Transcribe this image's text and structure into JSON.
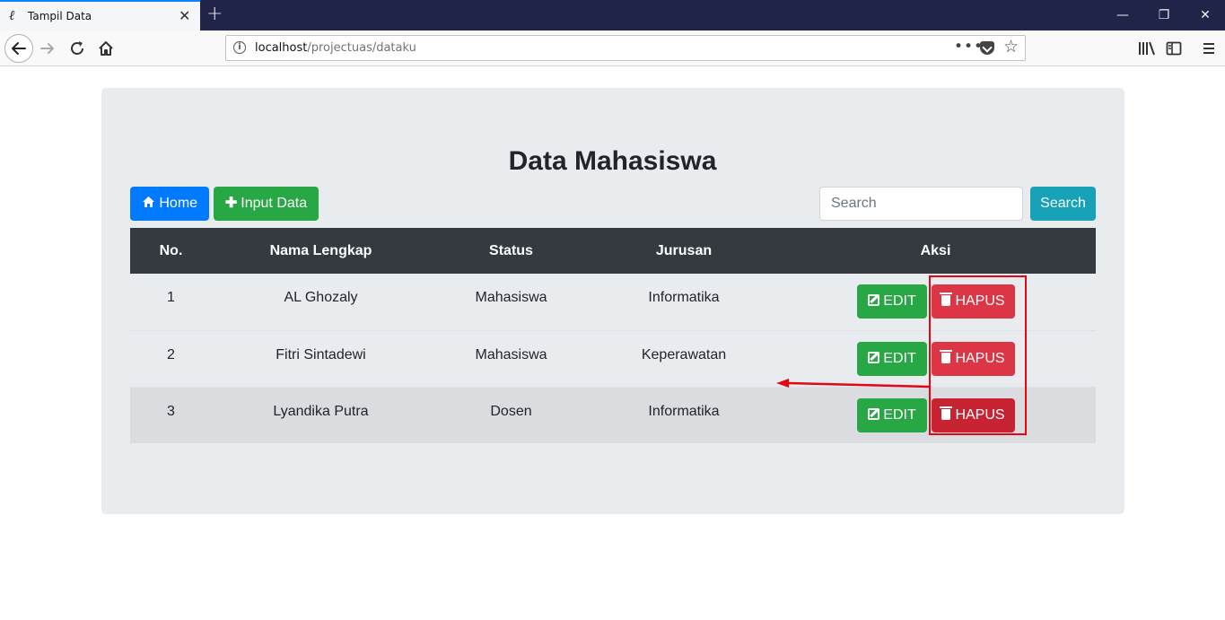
{
  "browser": {
    "tab_title": "Tampil Data",
    "tab_favicon": "ℓ",
    "tab_close": "✕",
    "new_tab": "+",
    "url_host": "localhost",
    "url_path": "/projectuas/dataku",
    "url_more": "•••",
    "window_minimize": "—",
    "window_restore": "❐",
    "window_close": "✕"
  },
  "page": {
    "title": "Data Mahasiswa",
    "home_button": "Home",
    "input_button": "Input Data",
    "search_placeholder": "Search",
    "search_button": "Search"
  },
  "table": {
    "headers": [
      "No.",
      "Nama Lengkap",
      "Status",
      "Jurusan",
      "Aksi"
    ],
    "rows": [
      {
        "no": "1",
        "nama": "AL Ghozaly",
        "status": "Mahasiswa",
        "jurusan": "Informatika",
        "edit": "EDIT",
        "hapus": "HAPUS"
      },
      {
        "no": "2",
        "nama": "Fitri Sintadewi",
        "status": "Mahasiswa",
        "jurusan": "Keperawatan",
        "edit": "EDIT",
        "hapus": "HAPUS"
      },
      {
        "no": "3",
        "nama": "Lyandika Putra",
        "status": "Dosen",
        "jurusan": "Informatika",
        "edit": "EDIT",
        "hapus": "HAPUS"
      }
    ]
  },
  "colors": {
    "primary": "#007bff",
    "success": "#28a745",
    "info": "#17a2b8",
    "danger": "#dc3545",
    "annotation": "#e30613"
  }
}
